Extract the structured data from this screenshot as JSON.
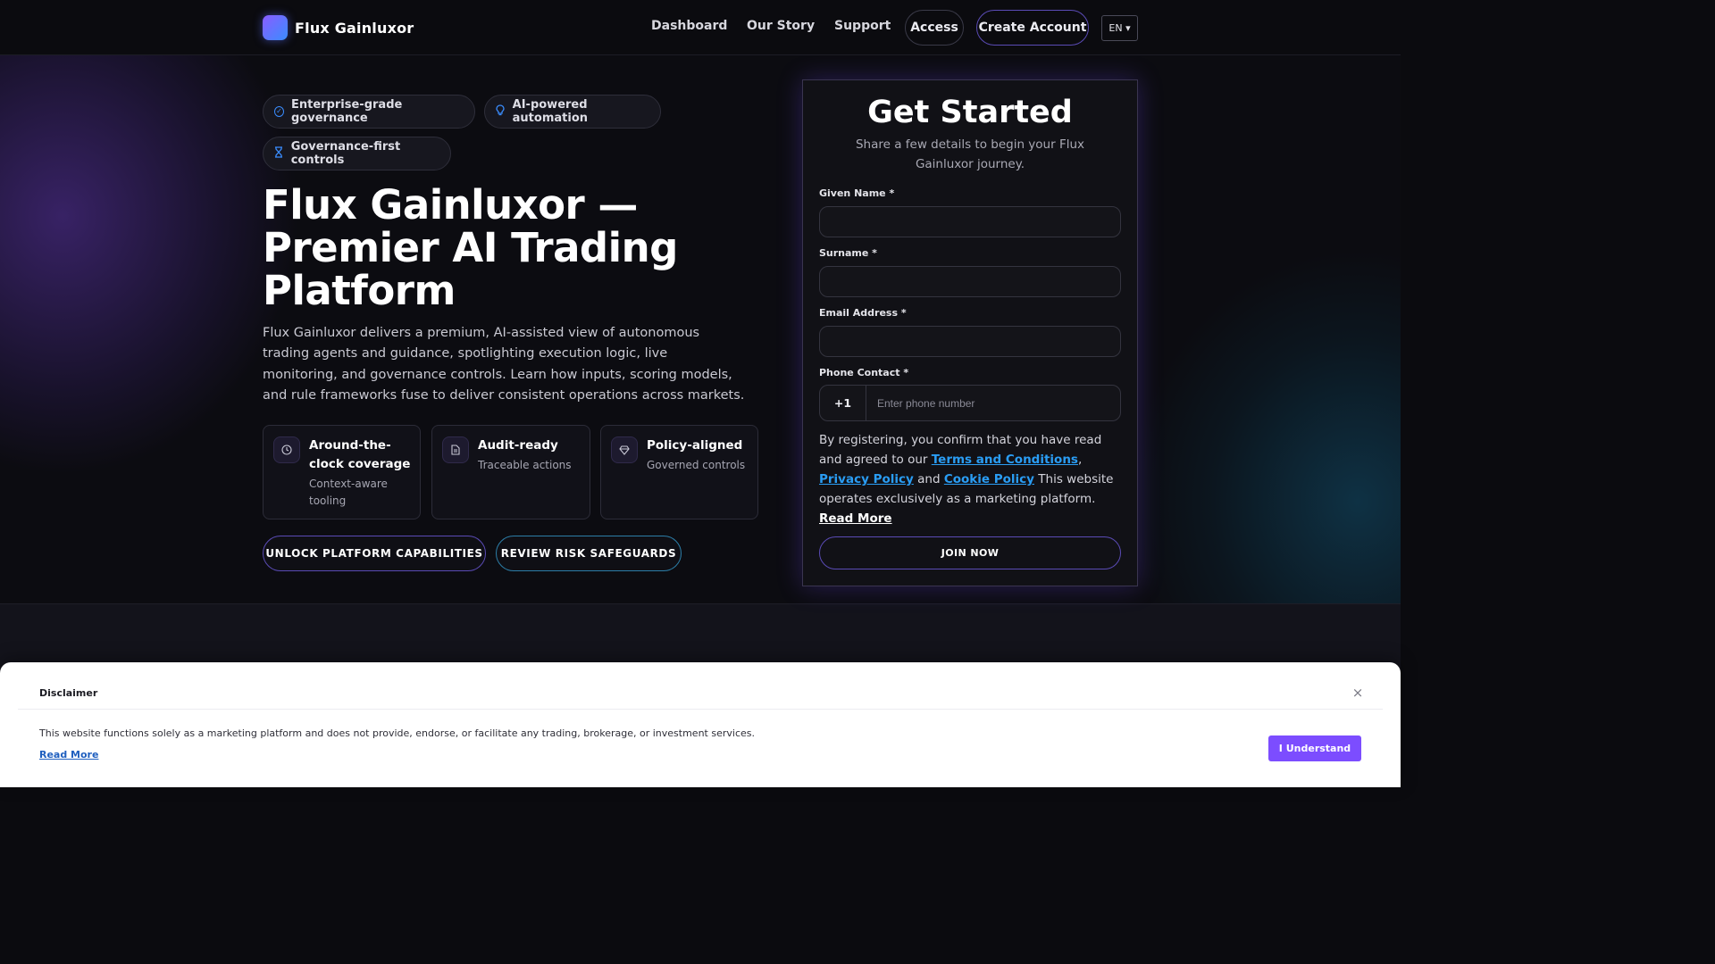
{
  "brand": {
    "name": "Flux Gainluxor"
  },
  "nav": {
    "links": [
      "Dashboard",
      "Our Story",
      "Support"
    ],
    "access": "Access",
    "create_account": "Create Account",
    "language": "EN ▾"
  },
  "hero": {
    "chips": [
      {
        "icon": "check-circle-icon",
        "label": "Enterprise-grade governance"
      },
      {
        "icon": "lightbulb-icon",
        "label": "AI-powered automation"
      },
      {
        "icon": "hourglass-icon",
        "label": "Governance-first controls"
      }
    ],
    "title": "Flux Gainluxor — Premier AI Trading Platform",
    "description": "Flux Gainluxor delivers a premium, AI-assisted view of autonomous trading agents and guidance, spotlighting execution logic, live monitoring, and governance controls. Learn how inputs, scoring models, and rule frameworks fuse to deliver consistent operations across markets.",
    "features": [
      {
        "icon": "clock-icon",
        "title": "Around-the-clock coverage",
        "subtitle": "Context-aware tooling"
      },
      {
        "icon": "document-icon",
        "title": "Audit-ready",
        "subtitle": "Traceable actions"
      },
      {
        "icon": "diamond-icon",
        "title": "Policy-aligned",
        "subtitle": "Governed controls"
      }
    ],
    "cta_primary": "UNLOCK PLATFORM CAPABILITIES",
    "cta_secondary": "REVIEW RISK SAFEGUARDS"
  },
  "form": {
    "title": "Get Started",
    "subtitle": "Share a few details to begin your Flux Gainluxor journey.",
    "given_name_label": "Given Name *",
    "given_name_value": "",
    "surname_label": "Surname *",
    "surname_value": "",
    "email_label": "Email Address *",
    "email_value": "",
    "phone_label": "Phone Contact *",
    "phone_code": "+1",
    "phone_placeholder": "Enter phone number",
    "consent_intro": "By registering, you confirm that you have read and agreed to our",
    "terms_link": "Terms and Conditions",
    "privacy_link": "Privacy Policy",
    "and_word": "and",
    "cookie_link": "Cookie Policy",
    "consent_outro": "This website operates exclusively as a marketing platform.",
    "read_more": "Read More",
    "submit": "JOIN NOW"
  },
  "disclaimer": {
    "title": "Disclaimer",
    "close": "×",
    "text": "This website functions solely as a marketing platform and does not provide, endorse, or facilitate any trading, brokerage, or investment services.",
    "read_more": "Read More",
    "accept": "I Understand"
  },
  "colors": {
    "accent_purple": "#7c4dff",
    "accent_blue": "#2a9df4",
    "background": "#0b0b0f"
  }
}
